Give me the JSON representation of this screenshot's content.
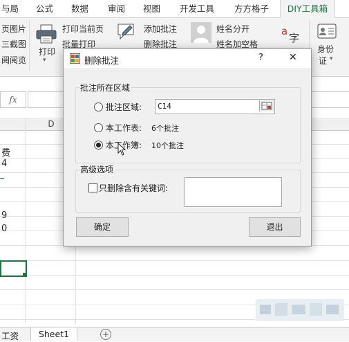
{
  "tabs": [
    "与局",
    "公式",
    "数据",
    "审阅",
    "视图",
    "开发工具",
    "方方格子",
    "DIY工具箱"
  ],
  "ribbon": {
    "left_items": [
      "页图片",
      "三截图",
      "阅阅览"
    ],
    "print_label": "打印",
    "print_current": "打印当前页",
    "batch_print": "批量打印",
    "add_comment": "添加批注",
    "delete_comment": "删除批注",
    "name_split": "姓名分开",
    "name_space": "姓名加空格",
    "id_card_label1": "身份",
    "id_card_label2": "证",
    "pinyin_top": "a",
    "pinyin_bottom": "字"
  },
  "formula_bar": {
    "fx": "fx"
  },
  "sheet": {
    "col_d": "D",
    "cells": [
      "费",
      "4",
      "9",
      "0"
    ]
  },
  "sheet_tabs": {
    "tab1": "工资",
    "tab2": "Sheet1",
    "add": "+"
  },
  "dialog": {
    "title": "删除批注",
    "help": "?",
    "close": "✕",
    "group1_title": "批注所在区域",
    "opt_region": "批注区域:",
    "region_value": "C14",
    "opt_sheet": "本工作表:",
    "sheet_count": "6个批注",
    "opt_workbook": "本工作簿:",
    "workbook_count": "10个批注",
    "group2_title": "高级选项",
    "keyword_label": "只删除含有关键词:",
    "keyword_value": "",
    "ok": "确定",
    "exit": "退出"
  },
  "colors": {
    "accent": "#217346",
    "dialog_bg": "#f0f0f0"
  }
}
